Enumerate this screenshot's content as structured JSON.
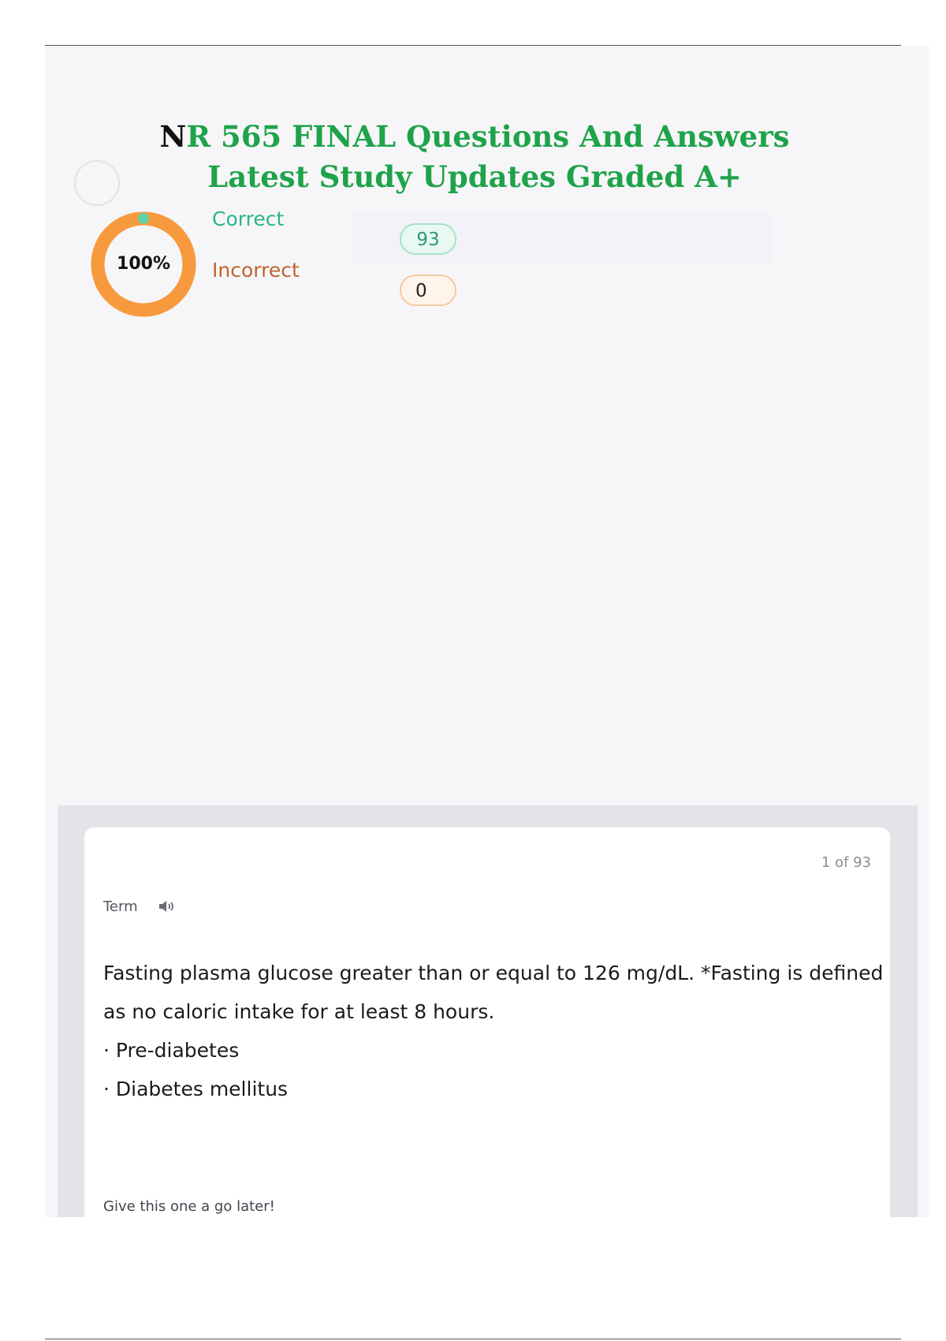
{
  "document": {
    "title_first_letter": "N",
    "title_rest": "R 565 FINAL Questions And Answers Latest Study Updates Graded A+"
  },
  "score": {
    "percent_label": "100%",
    "percent_value": 100,
    "correct_label": "Correct",
    "correct_count": "93",
    "incorrect_label": "Incorrect",
    "incorrect_count": "0"
  },
  "card": {
    "counter": "1 of 93",
    "side_label": "Term",
    "definition_line": "Fasting plasma glucose greater than or equal to 126 mg/dL. *Fasting is defined as no caloric intake for at least 8 hours.",
    "options": [
      "· Pre-diabetes",
      "· Diabetes mellitus"
    ],
    "footer_hint": "Give this one a go later!"
  },
  "colors": {
    "title_green": "#1fa34a",
    "donut_orange": "#f79a3e",
    "correct_green": "#2bb58a",
    "incorrect_orange": "#c0622e"
  },
  "icons": {
    "audio": "speaker-icon"
  }
}
